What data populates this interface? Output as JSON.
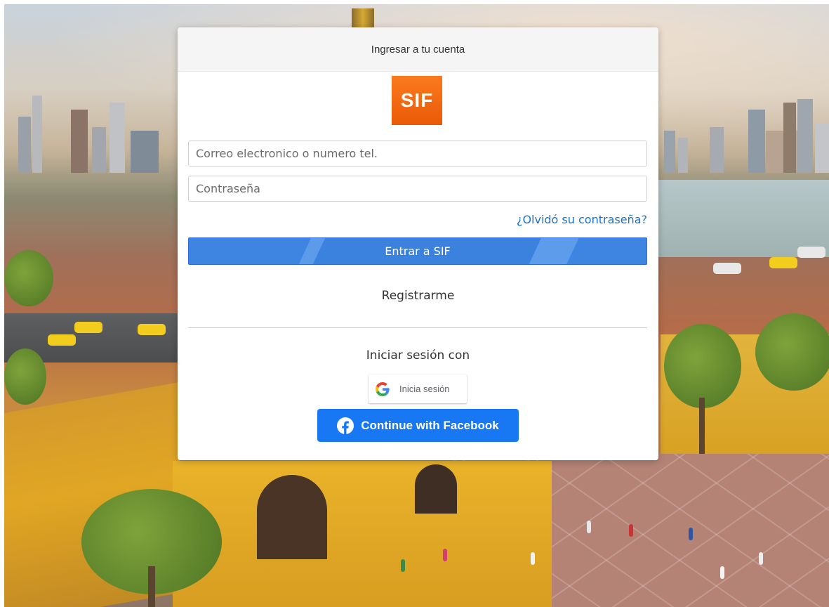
{
  "login_card": {
    "header_title": "Ingresar a tu cuenta",
    "logo_text": "SIF",
    "logo_color": "#f26a11",
    "email_placeholder": "Correo electronico o numero tel.",
    "password_placeholder": "Contraseña",
    "forgot_password_link": "¿Olvidó su contraseña?",
    "submit_button": "Entrar a SIF",
    "register_link": "Registrarme",
    "social_heading": "Iniciar sesión con",
    "google_button": "Inicia sesión",
    "google_icon": "google-g-icon",
    "facebook_button": "Continue with Facebook",
    "facebook_icon": "facebook-icon",
    "facebook_color": "#1877f2",
    "primary_color": "#3b82df"
  }
}
